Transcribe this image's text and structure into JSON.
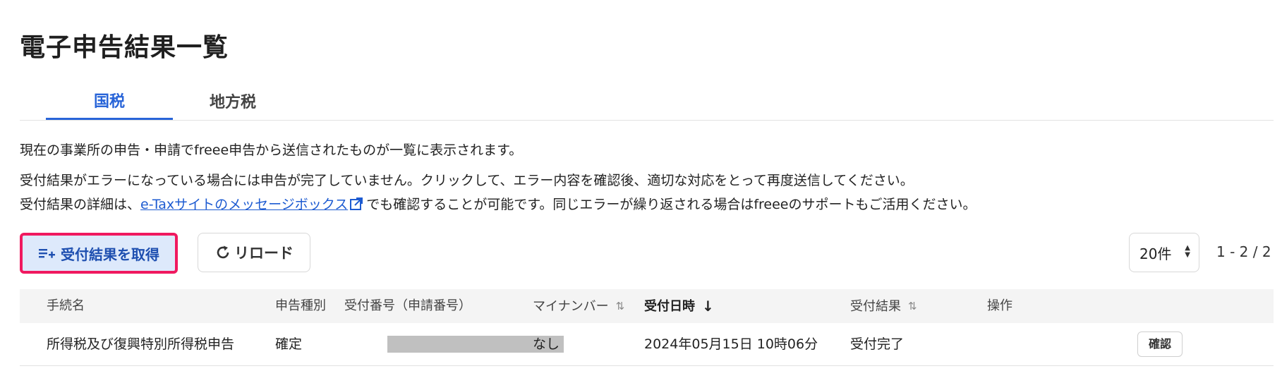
{
  "page": {
    "title": "電子申告結果一覧"
  },
  "tabs": [
    {
      "label": "国税",
      "active": true
    },
    {
      "label": "地方税",
      "active": false
    }
  ],
  "description": {
    "line1": "現在の事業所の申告・申請でfreee申告から送信されたものが一覧に表示されます。",
    "line2": "受付結果がエラーになっている場合には申告が完了していません。クリックして、エラー内容を確認後、適切な対応をとって再度送信してください。",
    "line3_prefix": "受付結果の詳細は、",
    "line3_link": "e-Taxサイトのメッセージボックス",
    "line3_suffix": "でも確認することが可能です。同じエラーが繰り返される場合はfreeeのサポートもご活用ください。"
  },
  "toolbar": {
    "fetch_label": "受付結果を取得",
    "reload_label": "リロード",
    "per_page": "20件",
    "pagination": "1 - 2 / 2"
  },
  "table": {
    "columns": [
      "手続名",
      "申告種別",
      "受付番号（申請番号）",
      "マイナンバー",
      "受付日時",
      "受付結果",
      "操作"
    ],
    "rows": [
      {
        "procedure": "所得税及び復興特別所得税申告",
        "type": "確定",
        "receipt_number": "",
        "my_number": "なし",
        "received_at": "2024年05月15日 10時06分",
        "result": "受付完了",
        "action": "確認"
      }
    ]
  },
  "colors": {
    "accent": "#2864d8",
    "highlight_border": "#f0195f",
    "fetch_bg": "#dde9fb"
  }
}
